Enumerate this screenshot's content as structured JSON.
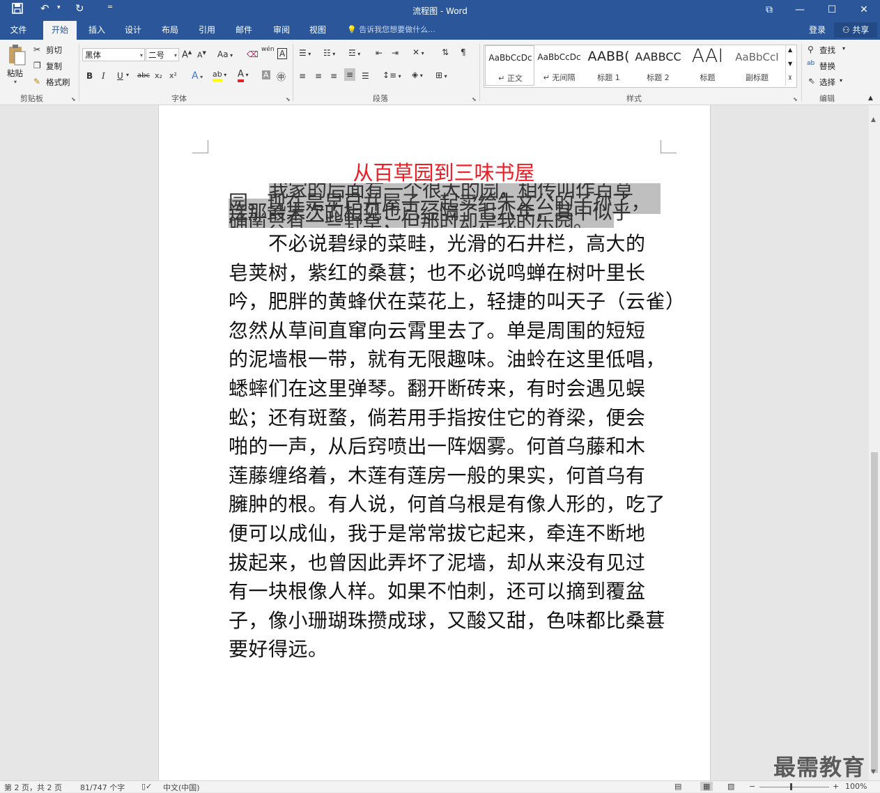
{
  "window": {
    "title": "流程图 - Word",
    "qat": {
      "save_icon": "save-icon",
      "undo_icon": "undo-icon",
      "redo_icon": "redo-icon",
      "customize_icon": "customize-icon"
    },
    "controls": {
      "ribbon_opts_icon": "ribbon-display-icon",
      "minimize": "—",
      "maximize": "☐",
      "close": "✕"
    }
  },
  "tabs": [
    {
      "label": "文件"
    },
    {
      "label": "开始",
      "active": true
    },
    {
      "label": "插入"
    },
    {
      "label": "设计"
    },
    {
      "label": "布局"
    },
    {
      "label": "引用"
    },
    {
      "label": "邮件"
    },
    {
      "label": "审阅"
    },
    {
      "label": "视图"
    }
  ],
  "tell_me": "告诉我您想要做什么...",
  "login": "登录",
  "share": "共享",
  "ribbon": {
    "clipboard": {
      "label": "剪贴板",
      "paste": "粘贴",
      "cut": "剪切",
      "copy": "复制",
      "format_painter": "格式刷"
    },
    "font": {
      "label": "字体",
      "name": "黑体",
      "size": "二号",
      "bold": "B",
      "italic": "I",
      "underline": "U",
      "strike": "abc",
      "sub": "x₂",
      "sup": "x²",
      "case": "Aa",
      "phonetic": "wén",
      "border_char": "A",
      "clear": "A"
    },
    "paragraph": {
      "label": "段落"
    },
    "styles": {
      "label": "样式",
      "items": [
        {
          "preview": "AaBbCcDc",
          "name": "↵ 正文"
        },
        {
          "preview": "AaBbCcDc",
          "name": "↵ 无间隔"
        },
        {
          "preview": "AABB(",
          "name": "标题 1"
        },
        {
          "preview": "AABBCC",
          "name": "标题 2"
        },
        {
          "preview": "AAI",
          "name": "标题"
        },
        {
          "preview": "AaBbCcI",
          "name": "副标题"
        }
      ]
    },
    "editing": {
      "label": "编辑",
      "find": "查找",
      "replace": "替换",
      "select": "选择"
    }
  },
  "document": {
    "title": "从百草园到三味书屋",
    "overlap_lines": [
      "我家的后面有一个很大的园，相传叫作百草",
      "园。现在是早已并屋子一起卖给朱文公的子孙了，",
      "连那最末次的相见也已经隔了七八年，其中似乎",
      "确凿只有一些野草；但那时却是我的乐园。"
    ],
    "body_lines": [
      "　　不必说碧绿的菜畦，光滑的石井栏，高大的",
      "皂荚树，紫红的桑葚；也不必说鸣蝉在树叶里长",
      "吟，肥胖的黄蜂伏在菜花上，轻捷的叫天子（云雀）",
      "忽然从草间直窜向云霄里去了。单是周围的短短",
      "的泥墙根一带，就有无限趣味。油蛉在这里低唱，",
      "蟋蟀们在这里弹琴。翻开断砖来，有时会遇见蜈",
      "蚣；还有斑蝥，倘若用手指按住它的脊梁，便会",
      "啪的一声，从后窍喷出一阵烟雾。何首乌藤和木",
      "莲藤缠络着，木莲有莲房一般的果实，何首乌有",
      "臃肿的根。有人说，何首乌根是有像人形的，吃了",
      "便可以成仙，我于是常常拔它起来，牵连不断地",
      "拔起来，也曾因此弄坏了泥墙，却从来没有见过",
      "有一块根像人样。如果不怕刺，还可以摘到覆盆",
      "子，像小珊瑚珠攒成球，又酸又甜，色味都比桑葚",
      "要好得远。"
    ]
  },
  "status": {
    "page": "第 2 页，共 2 页",
    "words": "81/747 个字",
    "language": "中文(中国)",
    "zoom": "100%"
  },
  "watermark": "最需教育",
  "colors": {
    "titlebar": "#2b579a",
    "title_red": "#ee1c24"
  }
}
